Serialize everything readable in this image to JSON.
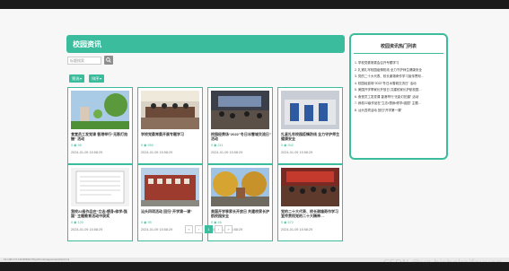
{
  "main": {
    "title": "校园资讯",
    "search_placeholder": "标题搜索",
    "filter_buttons": [
      "筛选",
      "排序"
    ]
  },
  "cards": [
    {
      "title": "食堂员工发党课 香港举行“无影灯拍摄” 活动",
      "stats": "0 ◉ 98",
      "date": "2024-01-09 15:58:29"
    },
    {
      "title": "学校党委常委开展专题学习",
      "stats": "0 ◉ 950",
      "date": "2024-01-09 15:58:29"
    },
    {
      "title": "校园经费场“2022”冬日冰雪城交流日” 活动",
      "stats": "0 ◉ 211",
      "date": "2024-01-09 15:58:29"
    },
    {
      "title": "扎紧扎牢校园疫情防线 全力守护师生健康安全",
      "stats": "0 ◉ 942",
      "date": "2024-01-09 15:58:29"
    },
    {
      "title": "我校22级作品在“立志•想身•修学•强国” 主题教育活动中获奖",
      "stats": "0 ◉ 120",
      "date": "2024-01-09 15:58:29"
    },
    {
      "title": "汕头四项活动 回归“开学第一课”",
      "stats": "0 ◉ 95",
      "date": "2024-01-09 15:58:29"
    },
    {
      "title": "美国开学季家长开放日 共建校家长护航校园安全",
      "stats": "0 ◉ 46",
      "date": "2024-01-09 15:58:29"
    },
    {
      "title": "党的二十大代表、校长谢雄奇作学习宣传贯彻党的二十大精神…",
      "stats": "0 ◉ 572",
      "date": "2024-01-09 15:58:29"
    }
  ],
  "sidebar": {
    "title": "校园资讯热门列表",
    "items": [
      "学校党委常委会召开专题学习",
      "扎紧扎牢校园疫情防线 全力守护师生健康安全",
      "党的二十大代表、校长谢雄奇作学习宣传贯彻…",
      "校园经费场“2022”冬日冰雪城交流日” 活动",
      "美国开学季家长开放日 共建校家长护航校园…",
      "食堂员工发党课 香港举行“无影灯拍摄” 活动",
      "我校22级作品在“立志•想身•修学•强国” 主题…",
      "汕头四项活动 回归“开学第一课”"
    ]
  },
  "pagination": {
    "prev2": "«",
    "prev": "‹",
    "current": "1",
    "next": "›",
    "next2": "»"
  },
  "statusbar": "19.138.173.130:8080/cl7fsyb/front/pages/news/list.html",
  "watermark": "CSDN @yz-bishekaifayuan"
}
